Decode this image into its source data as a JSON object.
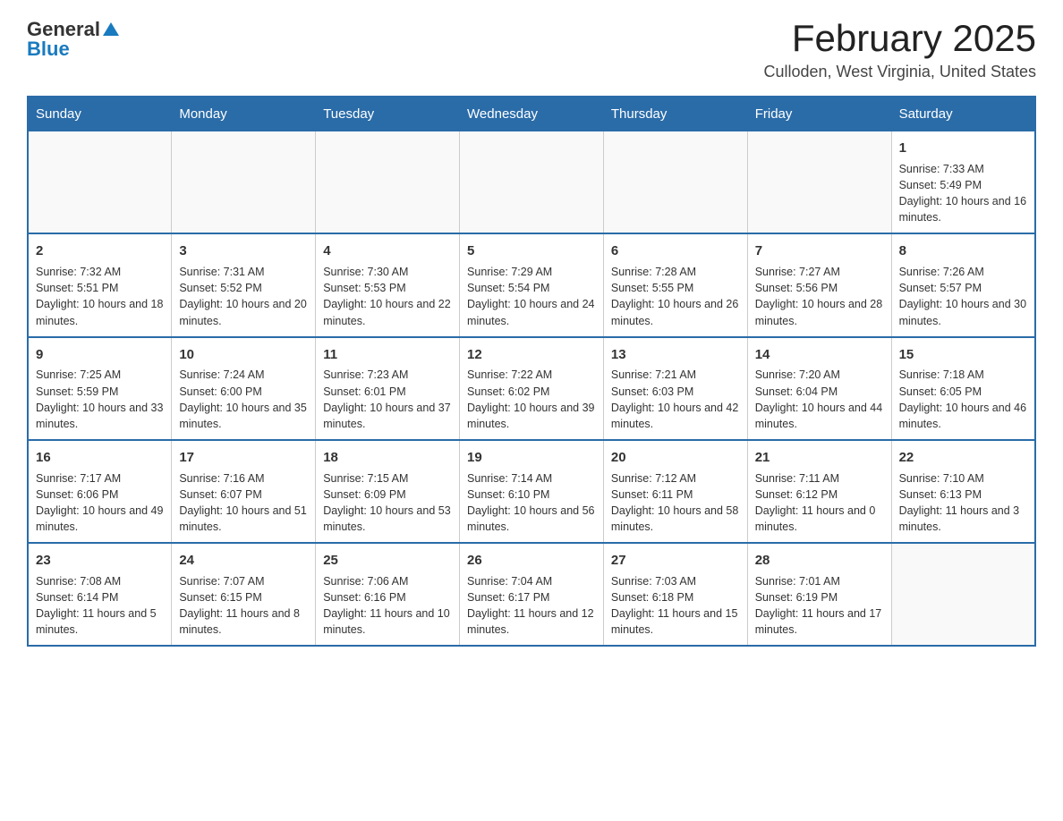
{
  "header": {
    "logo_general": "General",
    "logo_blue": "Blue",
    "title": "February 2025",
    "subtitle": "Culloden, West Virginia, United States"
  },
  "days_of_week": [
    "Sunday",
    "Monday",
    "Tuesday",
    "Wednesday",
    "Thursday",
    "Friday",
    "Saturday"
  ],
  "weeks": [
    [
      {
        "day": "",
        "sunrise": "",
        "sunset": "",
        "daylight": "",
        "empty": true
      },
      {
        "day": "",
        "sunrise": "",
        "sunset": "",
        "daylight": "",
        "empty": true
      },
      {
        "day": "",
        "sunrise": "",
        "sunset": "",
        "daylight": "",
        "empty": true
      },
      {
        "day": "",
        "sunrise": "",
        "sunset": "",
        "daylight": "",
        "empty": true
      },
      {
        "day": "",
        "sunrise": "",
        "sunset": "",
        "daylight": "",
        "empty": true
      },
      {
        "day": "",
        "sunrise": "",
        "sunset": "",
        "daylight": "",
        "empty": true
      },
      {
        "day": "1",
        "sunrise": "Sunrise: 7:33 AM",
        "sunset": "Sunset: 5:49 PM",
        "daylight": "Daylight: 10 hours and 16 minutes.",
        "empty": false
      }
    ],
    [
      {
        "day": "2",
        "sunrise": "Sunrise: 7:32 AM",
        "sunset": "Sunset: 5:51 PM",
        "daylight": "Daylight: 10 hours and 18 minutes.",
        "empty": false
      },
      {
        "day": "3",
        "sunrise": "Sunrise: 7:31 AM",
        "sunset": "Sunset: 5:52 PM",
        "daylight": "Daylight: 10 hours and 20 minutes.",
        "empty": false
      },
      {
        "day": "4",
        "sunrise": "Sunrise: 7:30 AM",
        "sunset": "Sunset: 5:53 PM",
        "daylight": "Daylight: 10 hours and 22 minutes.",
        "empty": false
      },
      {
        "day": "5",
        "sunrise": "Sunrise: 7:29 AM",
        "sunset": "Sunset: 5:54 PM",
        "daylight": "Daylight: 10 hours and 24 minutes.",
        "empty": false
      },
      {
        "day": "6",
        "sunrise": "Sunrise: 7:28 AM",
        "sunset": "Sunset: 5:55 PM",
        "daylight": "Daylight: 10 hours and 26 minutes.",
        "empty": false
      },
      {
        "day": "7",
        "sunrise": "Sunrise: 7:27 AM",
        "sunset": "Sunset: 5:56 PM",
        "daylight": "Daylight: 10 hours and 28 minutes.",
        "empty": false
      },
      {
        "day": "8",
        "sunrise": "Sunrise: 7:26 AM",
        "sunset": "Sunset: 5:57 PM",
        "daylight": "Daylight: 10 hours and 30 minutes.",
        "empty": false
      }
    ],
    [
      {
        "day": "9",
        "sunrise": "Sunrise: 7:25 AM",
        "sunset": "Sunset: 5:59 PM",
        "daylight": "Daylight: 10 hours and 33 minutes.",
        "empty": false
      },
      {
        "day": "10",
        "sunrise": "Sunrise: 7:24 AM",
        "sunset": "Sunset: 6:00 PM",
        "daylight": "Daylight: 10 hours and 35 minutes.",
        "empty": false
      },
      {
        "day": "11",
        "sunrise": "Sunrise: 7:23 AM",
        "sunset": "Sunset: 6:01 PM",
        "daylight": "Daylight: 10 hours and 37 minutes.",
        "empty": false
      },
      {
        "day": "12",
        "sunrise": "Sunrise: 7:22 AM",
        "sunset": "Sunset: 6:02 PM",
        "daylight": "Daylight: 10 hours and 39 minutes.",
        "empty": false
      },
      {
        "day": "13",
        "sunrise": "Sunrise: 7:21 AM",
        "sunset": "Sunset: 6:03 PM",
        "daylight": "Daylight: 10 hours and 42 minutes.",
        "empty": false
      },
      {
        "day": "14",
        "sunrise": "Sunrise: 7:20 AM",
        "sunset": "Sunset: 6:04 PM",
        "daylight": "Daylight: 10 hours and 44 minutes.",
        "empty": false
      },
      {
        "day": "15",
        "sunrise": "Sunrise: 7:18 AM",
        "sunset": "Sunset: 6:05 PM",
        "daylight": "Daylight: 10 hours and 46 minutes.",
        "empty": false
      }
    ],
    [
      {
        "day": "16",
        "sunrise": "Sunrise: 7:17 AM",
        "sunset": "Sunset: 6:06 PM",
        "daylight": "Daylight: 10 hours and 49 minutes.",
        "empty": false
      },
      {
        "day": "17",
        "sunrise": "Sunrise: 7:16 AM",
        "sunset": "Sunset: 6:07 PM",
        "daylight": "Daylight: 10 hours and 51 minutes.",
        "empty": false
      },
      {
        "day": "18",
        "sunrise": "Sunrise: 7:15 AM",
        "sunset": "Sunset: 6:09 PM",
        "daylight": "Daylight: 10 hours and 53 minutes.",
        "empty": false
      },
      {
        "day": "19",
        "sunrise": "Sunrise: 7:14 AM",
        "sunset": "Sunset: 6:10 PM",
        "daylight": "Daylight: 10 hours and 56 minutes.",
        "empty": false
      },
      {
        "day": "20",
        "sunrise": "Sunrise: 7:12 AM",
        "sunset": "Sunset: 6:11 PM",
        "daylight": "Daylight: 10 hours and 58 minutes.",
        "empty": false
      },
      {
        "day": "21",
        "sunrise": "Sunrise: 7:11 AM",
        "sunset": "Sunset: 6:12 PM",
        "daylight": "Daylight: 11 hours and 0 minutes.",
        "empty": false
      },
      {
        "day": "22",
        "sunrise": "Sunrise: 7:10 AM",
        "sunset": "Sunset: 6:13 PM",
        "daylight": "Daylight: 11 hours and 3 minutes.",
        "empty": false
      }
    ],
    [
      {
        "day": "23",
        "sunrise": "Sunrise: 7:08 AM",
        "sunset": "Sunset: 6:14 PM",
        "daylight": "Daylight: 11 hours and 5 minutes.",
        "empty": false
      },
      {
        "day": "24",
        "sunrise": "Sunrise: 7:07 AM",
        "sunset": "Sunset: 6:15 PM",
        "daylight": "Daylight: 11 hours and 8 minutes.",
        "empty": false
      },
      {
        "day": "25",
        "sunrise": "Sunrise: 7:06 AM",
        "sunset": "Sunset: 6:16 PM",
        "daylight": "Daylight: 11 hours and 10 minutes.",
        "empty": false
      },
      {
        "day": "26",
        "sunrise": "Sunrise: 7:04 AM",
        "sunset": "Sunset: 6:17 PM",
        "daylight": "Daylight: 11 hours and 12 minutes.",
        "empty": false
      },
      {
        "day": "27",
        "sunrise": "Sunrise: 7:03 AM",
        "sunset": "Sunset: 6:18 PM",
        "daylight": "Daylight: 11 hours and 15 minutes.",
        "empty": false
      },
      {
        "day": "28",
        "sunrise": "Sunrise: 7:01 AM",
        "sunset": "Sunset: 6:19 PM",
        "daylight": "Daylight: 11 hours and 17 minutes.",
        "empty": false
      },
      {
        "day": "",
        "sunrise": "",
        "sunset": "",
        "daylight": "",
        "empty": true
      }
    ]
  ]
}
